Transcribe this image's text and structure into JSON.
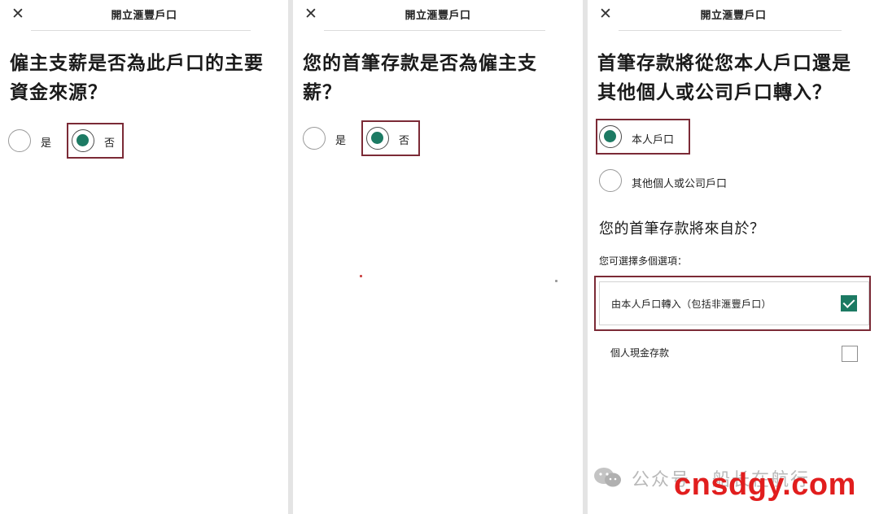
{
  "header": {
    "title": "開立滙豐戶口",
    "close_icon": "close-icon"
  },
  "screen1": {
    "question": "僱主支薪是否為此戶口的主要資金來源？",
    "options": [
      {
        "label": "是",
        "selected": false
      },
      {
        "label": "否",
        "selected": true
      }
    ]
  },
  "screen2": {
    "question": "您的首筆存款是否為僱主支薪？",
    "options": [
      {
        "label": "是",
        "selected": false
      },
      {
        "label": "否",
        "selected": true
      }
    ]
  },
  "screen3": {
    "question": "首筆存款將從您本人戶口還是其他個人或公司戶口轉入？",
    "options": [
      {
        "label": "本人戶口",
        "selected": true
      },
      {
        "label": "其他個人或公司戶口",
        "selected": false
      }
    ],
    "subquestion": "您的首筆存款將來自於？",
    "hint": "您可選擇多個選項：",
    "checkboxes": [
      {
        "label": "由本人戶口轉入（包括非滙豐戶口）",
        "checked": true
      },
      {
        "label": "個人現金存款",
        "checked": false
      }
    ]
  },
  "watermark": {
    "text": "公众号 · 船长在航行",
    "icon": "wechat-icon"
  },
  "brand": "cnsdgy.com",
  "colors": {
    "accent": "#1c7a63",
    "highlight": "#7b2a36",
    "brand": "#e11e1e"
  }
}
